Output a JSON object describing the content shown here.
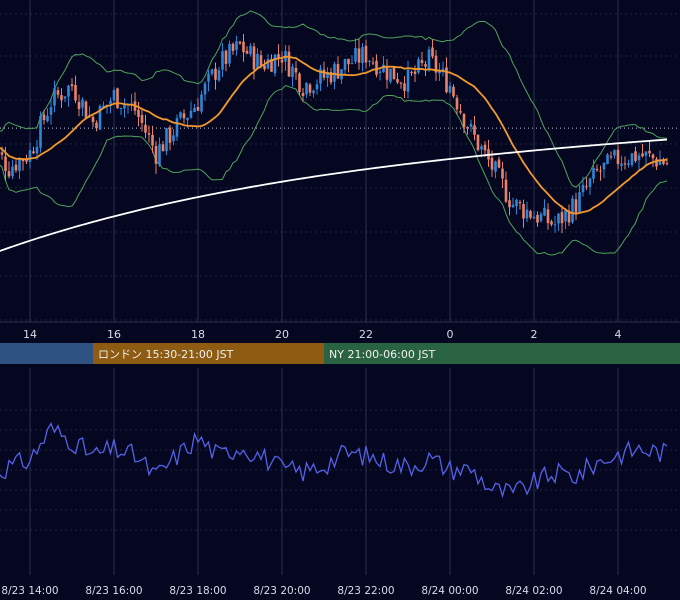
{
  "colors": {
    "background": "#050720",
    "grid": "#2b3150",
    "candle_up": "#2f86d6",
    "candle_down": "#e8826a",
    "ma_fast": "#f2992e",
    "ma_slow": "#ffffff",
    "bollinger": "#4fa35a",
    "oscillator": "#5561e6",
    "tick_text": "#d9dbe8"
  },
  "price_axis_ticks": [
    "14",
    "16",
    "18",
    "20",
    "22",
    "0",
    "2",
    "4"
  ],
  "time_axis_ticks": [
    "8/23 14:00",
    "8/23 16:00",
    "8/23 18:00",
    "8/23 20:00",
    "8/23 22:00",
    "8/24 00:00",
    "8/24 02:00",
    "8/24 04:00"
  ],
  "sessions": [
    {
      "label": "",
      "color": "#2e5282",
      "start_hour": 13.0,
      "end_hour": 15.5
    },
    {
      "label": "ロンドン 15:30-21:00 JST",
      "color": "#8d5b12",
      "start_hour": 15.5,
      "end_hour": 21.0
    },
    {
      "label": "NY 21:00-06:00 JST",
      "color": "#2a6342",
      "start_hour": 21.0,
      "end_hour": 30.0
    }
  ],
  "chart_data": [
    {
      "type": "candlestick",
      "title": "",
      "x_unit": "hour (JST), 8/23 13:00 → 8/24 05:10",
      "xlim": [
        13.0,
        29.18
      ],
      "ylim": [
        0,
        1
      ],
      "x_ticks": [
        "14",
        "16",
        "18",
        "20",
        "22",
        "0",
        "2",
        "4"
      ],
      "horizontal_dotted_line": 0.57,
      "overlays": [
        "moving average (orange)",
        "long moving average (white)",
        "Bollinger bands (green)"
      ],
      "anchors": [
        {
          "t": 13.0,
          "v": 0.5
        },
        {
          "t": 13.5,
          "v": 0.38
        },
        {
          "t": 14.0,
          "v": 0.45
        },
        {
          "t": 14.5,
          "v": 0.7
        },
        {
          "t": 15.0,
          "v": 0.78
        },
        {
          "t": 15.5,
          "v": 0.6
        },
        {
          "t": 16.0,
          "v": 0.73
        },
        {
          "t": 16.5,
          "v": 0.66
        },
        {
          "t": 17.0,
          "v": 0.45
        },
        {
          "t": 17.5,
          "v": 0.58
        },
        {
          "t": 18.0,
          "v": 0.7
        },
        {
          "t": 18.5,
          "v": 0.88
        },
        {
          "t": 19.0,
          "v": 0.97
        },
        {
          "t": 19.5,
          "v": 0.88
        },
        {
          "t": 20.0,
          "v": 0.93
        },
        {
          "t": 20.5,
          "v": 0.78
        },
        {
          "t": 21.0,
          "v": 0.82
        },
        {
          "t": 21.5,
          "v": 0.88
        },
        {
          "t": 22.0,
          "v": 0.93
        },
        {
          "t": 22.5,
          "v": 0.85
        },
        {
          "t": 23.0,
          "v": 0.8
        },
        {
          "t": 23.5,
          "v": 0.9
        },
        {
          "t": 24.0,
          "v": 0.78
        },
        {
          "t": 24.5,
          "v": 0.55
        },
        {
          "t": 25.0,
          "v": 0.38
        },
        {
          "t": 25.5,
          "v": 0.2
        },
        {
          "t": 26.0,
          "v": 0.15
        },
        {
          "t": 26.5,
          "v": 0.1
        },
        {
          "t": 27.0,
          "v": 0.2
        },
        {
          "t": 27.5,
          "v": 0.35
        },
        {
          "t": 28.0,
          "v": 0.42
        },
        {
          "t": 28.5,
          "v": 0.44
        },
        {
          "t": 29.18,
          "v": 0.4
        }
      ]
    },
    {
      "type": "line",
      "title": "",
      "x_unit": "hour (JST)",
      "xlim": [
        13.0,
        29.18
      ],
      "ylim": [
        0,
        1
      ],
      "x_ticks": [
        "8/23 14:00",
        "8/23 16:00",
        "8/23 18:00",
        "8/23 20:00",
        "8/23 22:00",
        "8/24 00:00",
        "8/24 02:00",
        "8/24 04:00"
      ],
      "series": [
        {
          "points": [
            [
              13.0,
              0.4
            ],
            [
              13.5,
              0.47
            ],
            [
              14.0,
              0.52
            ],
            [
              14.5,
              0.75
            ],
            [
              15.0,
              0.66
            ],
            [
              15.5,
              0.55
            ],
            [
              16.0,
              0.6
            ],
            [
              16.5,
              0.55
            ],
            [
              17.0,
              0.4
            ],
            [
              17.5,
              0.55
            ],
            [
              18.0,
              0.68
            ],
            [
              18.5,
              0.55
            ],
            [
              19.0,
              0.62
            ],
            [
              19.5,
              0.55
            ],
            [
              20.0,
              0.45
            ],
            [
              20.5,
              0.43
            ],
            [
              21.0,
              0.48
            ],
            [
              21.5,
              0.57
            ],
            [
              22.0,
              0.55
            ],
            [
              22.5,
              0.5
            ],
            [
              23.0,
              0.47
            ],
            [
              23.5,
              0.53
            ],
            [
              24.0,
              0.45
            ],
            [
              24.5,
              0.45
            ],
            [
              25.0,
              0.3
            ],
            [
              25.5,
              0.27
            ],
            [
              26.0,
              0.35
            ],
            [
              26.5,
              0.42
            ],
            [
              27.0,
              0.4
            ],
            [
              27.5,
              0.5
            ],
            [
              28.0,
              0.56
            ],
            [
              28.5,
              0.6
            ],
            [
              29.18,
              0.57
            ]
          ]
        }
      ]
    }
  ]
}
